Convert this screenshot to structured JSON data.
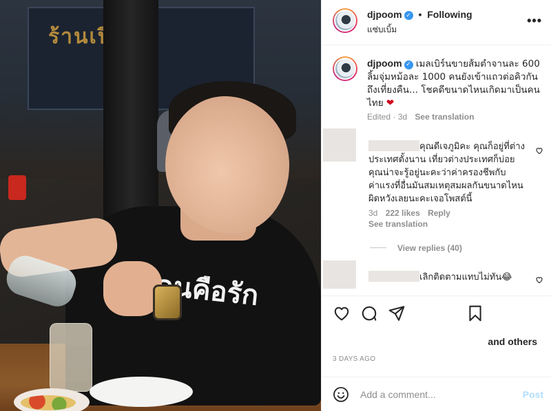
{
  "photo": {
    "sign_text": "ร้านเปิ",
    "shirt_text": "คนคือรัก"
  },
  "post": {
    "username": "djpoom",
    "verified_mark": "✓",
    "follow_separator": "•",
    "follow_status": "Following",
    "location": "แซ่บเบิ้ม",
    "more_glyph": "•••"
  },
  "caption": {
    "username": "djpoom",
    "text": "เมลเบิร์นขายส้มตำจานละ 600 ลิ้มจุ่มหม้อละ 1000 คนยังเข้าแถวต่อคิวกันถึงเที่ยงคืน... โชคดีขนาดไหนเกิดมาเป็นคนไทย",
    "emoji": "❤",
    "edited": "Edited · 3d",
    "see_translation": "See translation"
  },
  "comments": [
    {
      "text": "คุณดีเจภูมิคะ คุณก็อยู่ที่ต่างประเทศตั้งนาน เที่ยวต่างประเทศก็บ่อย คุณน่าจะรู้อยู่นะคะว่าค่าครองชีพกับค่าแรงที่อื่นมันสมเหตุสมผลกันขนาดไหน ผิดหวังเลยนะคะเจอโพสต์นี้",
      "age": "3d",
      "likes": "222 likes",
      "reply": "Reply",
      "see_translation": "See translation",
      "view_replies": "View replies (40)"
    },
    {
      "text": "เลิกติดตามแทบไม่ทัน😂"
    }
  ],
  "actions": {
    "likes_suffix": "and others",
    "timestamp": "3 DAYS AGO"
  },
  "composer": {
    "placeholder": "Add a comment...",
    "post_label": "Post"
  },
  "colors": {
    "verified": "#3897f0",
    "post_disabled": "#b2dffc",
    "secondary_text": "#8e8e8e"
  },
  "icons": [
    "verified-icon",
    "more-options-icon",
    "heart-icon",
    "comment-icon",
    "share-icon",
    "bookmark-icon",
    "emoji-icon"
  ]
}
